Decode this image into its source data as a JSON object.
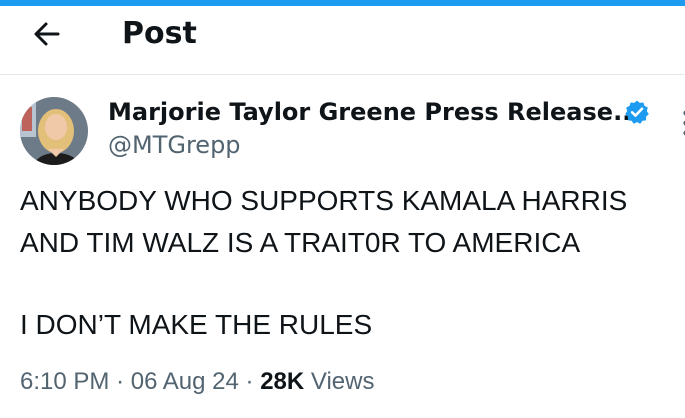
{
  "header": {
    "title": "Post",
    "back_icon": "arrow-left-icon"
  },
  "post": {
    "author": {
      "name": "Marjorie Taylor Greene Press Release...",
      "handle": "@MTGrepp",
      "verified_icon": "verified-badge-icon",
      "verified_color": "#1d9bf0"
    },
    "text_lines": [
      "ANYBODY WHO SUPPORTS KAMALA HARRIS",
      "AND TIM WALZ IS A TRAIT0R TO AMERICA",
      "I DON’T MAKE THE RULES"
    ],
    "time": "6:10 PM",
    "separator": "·",
    "date": "06 Aug 24",
    "views_count": "28K",
    "views_label": "Views"
  },
  "colors": {
    "accent": "#1d9bf0",
    "text": "#0f1419",
    "secondary": "#536471",
    "divider": "#e6e9eb"
  }
}
